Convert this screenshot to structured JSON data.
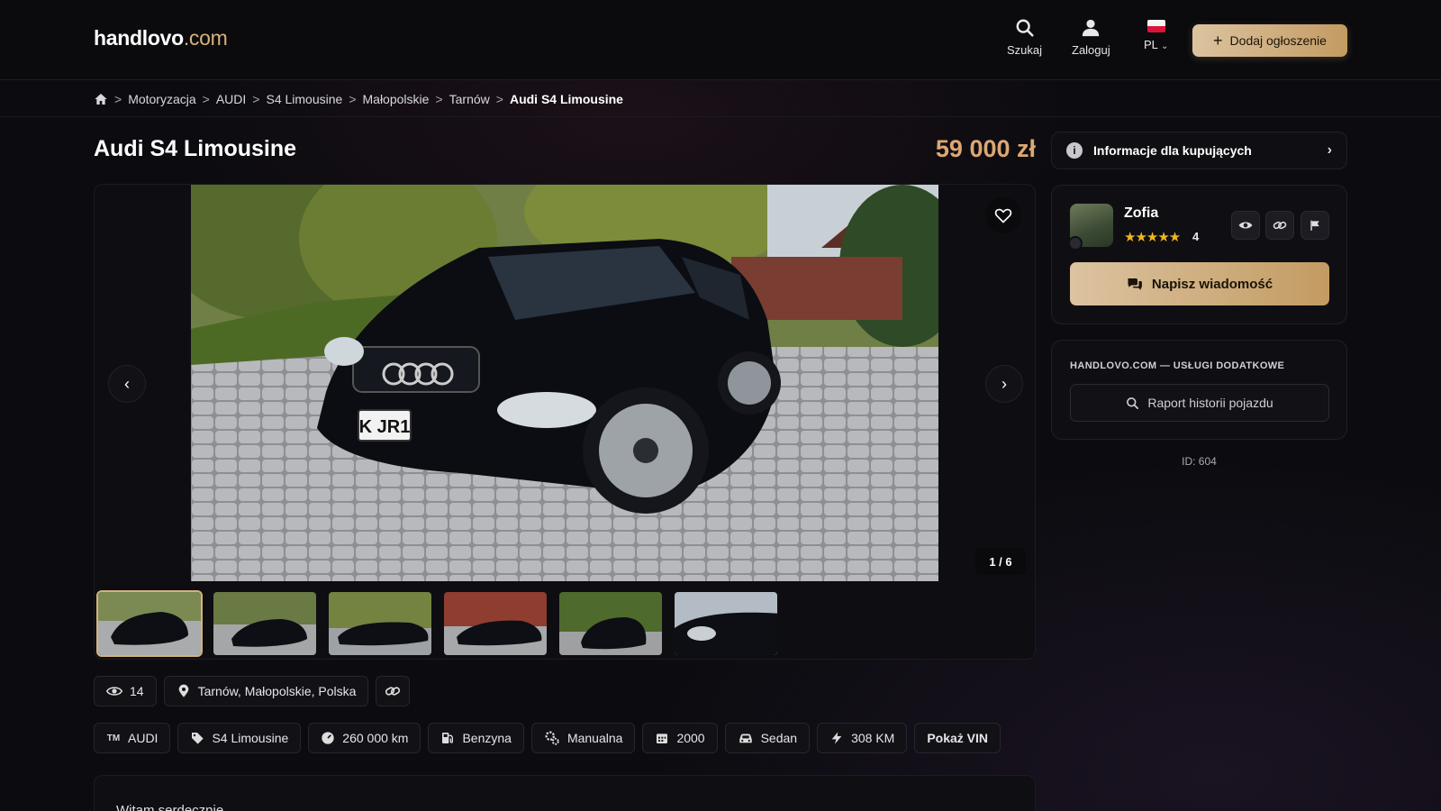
{
  "header": {
    "logo_main": "handlovo",
    "logo_domain": ".com",
    "search_label": "Szukaj",
    "login_label": "Zaloguj",
    "lang_label": "PL",
    "add_button_label": "Dodaj ogłoszenie"
  },
  "breadcrumb": {
    "items": [
      "Motoryzacja",
      "AUDI",
      "S4 Limousine",
      "Małopolskie",
      "Tarnów"
    ],
    "separator": ">",
    "current": "Audi S4 Limousine"
  },
  "listing": {
    "title": "Audi S4 Limousine",
    "price": "59 000 zł",
    "photo_counter": "1 / 6",
    "thumbnail_count": 6,
    "active_thumbnail": 1,
    "views": "14",
    "location": "Tarnów, Małopolskie, Polska",
    "specs": {
      "brand_prefix": "TM",
      "brand": "AUDI",
      "model": "S4 Limousine",
      "mileage": "260 000 km",
      "fuel": "Benzyna",
      "gearbox": "Manualna",
      "year": "2000",
      "body": "Sedan",
      "power": "308 KM",
      "vin_button": "Pokaż VIN"
    },
    "description_start": "Witam serdecznie"
  },
  "sidebar": {
    "buyer_info_label": "Informacje dla kupujących",
    "seller_name": "Zofia",
    "seller_stars": "★★★★★",
    "seller_rating": "4",
    "message_button": "Napisz wiadomość",
    "services_title": "HANDLOVO.COM — USŁUGI DODATKOWE",
    "report_button": "Raport historii pojazdu",
    "listing_id": "ID: 604"
  },
  "colors": {
    "accent_gold": "#d7b27c",
    "price": "#dca774",
    "background": "#0c0c10"
  }
}
